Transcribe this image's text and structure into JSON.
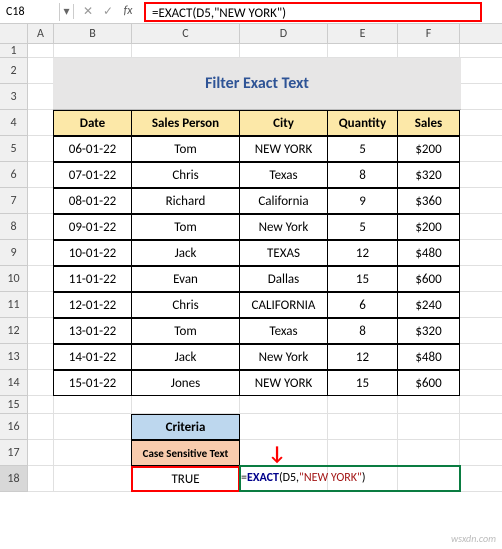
{
  "cell_ref": "C18",
  "formula": "=EXACT(D5,\"NEW YORK\")",
  "title": "Filter Exact Text",
  "columns": [
    "A",
    "B",
    "C",
    "D",
    "E",
    "F"
  ],
  "rows": [
    "1",
    "2",
    "3",
    "4",
    "5",
    "6",
    "7",
    "8",
    "9",
    "10",
    "11",
    "12",
    "13",
    "14",
    "15",
    "16",
    "17",
    "18"
  ],
  "headers": {
    "date": "Date",
    "salesperson": "Sales Person",
    "city": "City",
    "qty": "Quantity",
    "sales": "Sales"
  },
  "data": [
    {
      "date": "06-01-22",
      "sp": "Tom",
      "city": "NEW YORK",
      "q": "5",
      "s": "$200"
    },
    {
      "date": "07-01-22",
      "sp": "Chris",
      "city": "Texas",
      "q": "8",
      "s": "$320"
    },
    {
      "date": "08-01-22",
      "sp": "Richard",
      "city": "California",
      "q": "9",
      "s": "$360"
    },
    {
      "date": "09-01-22",
      "sp": "Tom",
      "city": "New York",
      "q": "5",
      "s": "$200"
    },
    {
      "date": "10-01-22",
      "sp": "Jack",
      "city": "TEXAS",
      "q": "12",
      "s": "$480"
    },
    {
      "date": "11-01-22",
      "sp": "Evan",
      "city": "Dallas",
      "q": "15",
      "s": "$600"
    },
    {
      "date": "12-01-22",
      "sp": "Chris",
      "city": "CALIFORNIA",
      "q": "6",
      "s": "$240"
    },
    {
      "date": "13-01-22",
      "sp": "Tom",
      "city": "Texas",
      "q": "8",
      "s": "$320"
    },
    {
      "date": "14-01-22",
      "sp": "Jack",
      "city": "New York",
      "q": "12",
      "s": "$480"
    },
    {
      "date": "15-01-22",
      "sp": "Jones",
      "city": "NEW YORK",
      "q": "15",
      "s": "$600"
    }
  ],
  "criteria_h1": "Criteria",
  "criteria_h2": "Case Sensitive Text",
  "criteria_val": "TRUE",
  "inline_formula": "=EXACT(D5,\"NEW YORK\")",
  "watermark": "wsxdn.com"
}
